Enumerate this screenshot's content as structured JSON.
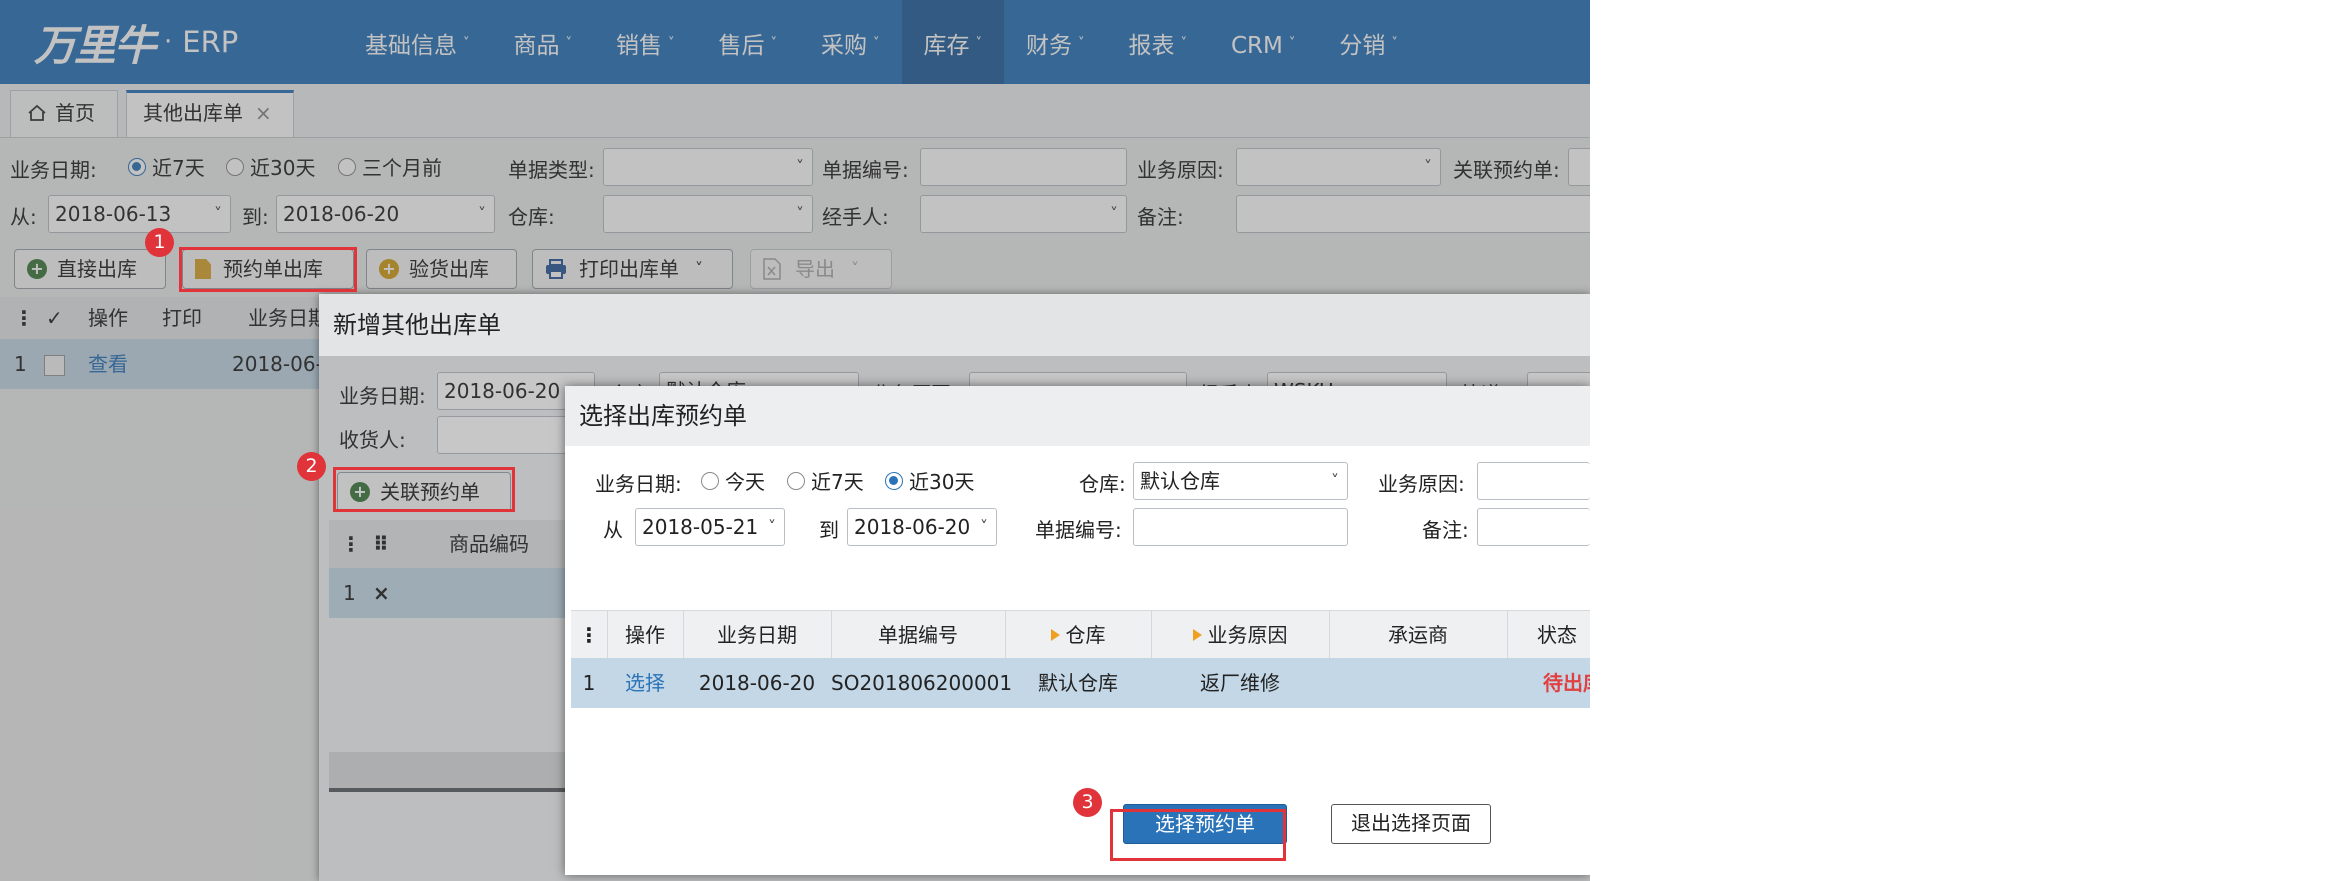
{
  "brand": {
    "logo_text": "万里牛",
    "separator": "·",
    "product": "ERP"
  },
  "nav": {
    "items": [
      {
        "label": "基础信息"
      },
      {
        "label": "商品"
      },
      {
        "label": "销售"
      },
      {
        "label": "售后"
      },
      {
        "label": "采购"
      },
      {
        "label": "库存",
        "active": true
      },
      {
        "label": "财务"
      },
      {
        "label": "报表"
      },
      {
        "label": "CRM"
      },
      {
        "label": "分销"
      }
    ],
    "caret": "˅"
  },
  "tabs": {
    "home": "首页",
    "current": "其他出库单",
    "close": "×"
  },
  "filters": {
    "date_label": "业务日期:",
    "radio_7": "近7天",
    "radio_30": "近30天",
    "radio_3m": "三个月前",
    "selected_range": "近7天",
    "from_label": "从:",
    "from_value": "2018-06-13",
    "to_label": "到:",
    "to_value": "2018-06-20",
    "doc_type_label": "单据类型:",
    "doc_no_label": "单据编号:",
    "reason_label": "业务原因:",
    "linked_label": "关联预约单:",
    "warehouse_label": "仓库:",
    "handler_label": "经手人:",
    "remark_label": "备注:"
  },
  "toolbar": {
    "direct": "直接出库",
    "reserve": "预约单出库",
    "inspect": "验货出库",
    "print": "打印出库单",
    "export": "导出"
  },
  "grid": {
    "headers": {
      "op": "操作",
      "print": "打印",
      "date": "业务日期"
    },
    "row": {
      "index": "1",
      "view": "查看",
      "date": "2018-06-"
    }
  },
  "dialog1": {
    "title": "新增其他出库单",
    "date_label": "业务日期:",
    "date_value": "2018-06-20",
    "warehouse_label": "仓库",
    "warehouse_value": "默认仓库",
    "reason_label": "业务原因",
    "handler_label": "经手人",
    "handler_value": "WSKU",
    "logistics_label": "快递",
    "receiver_label": "收货人:",
    "link_button": "关联预约单",
    "table_header_code": "商品编码",
    "row_index": "1",
    "row_delete": "×"
  },
  "dialog2": {
    "title": "选择出库预约单",
    "date_label": "业务日期:",
    "radio_today": "今天",
    "radio_7": "近7天",
    "radio_30": "近30天",
    "selected_range": "近30天",
    "from_label": "从",
    "from_value": "2018-05-21",
    "to_label": "到",
    "to_value": "2018-06-20",
    "warehouse_label": "仓库:",
    "warehouse_value": "默认仓库",
    "doc_no_label": "单据编号:",
    "reason_label": "业务原因:",
    "remark_label": "备注:",
    "columns": [
      "操作",
      "业务日期",
      "单据编号",
      "仓库",
      "业务原因",
      "承运商",
      "状态"
    ],
    "row": {
      "index": "1",
      "action": "选择",
      "date": "2018-06-20",
      "doc_no": "SO201806200001",
      "warehouse": "默认仓库",
      "reason": "返厂维修",
      "carrier": "",
      "status": "待出库"
    },
    "confirm_button": "选择预约单",
    "exit_button": "退出选择页面"
  },
  "callouts": [
    "1",
    "2",
    "3"
  ],
  "colors": {
    "nav_bg": "#2a73b8",
    "highlight": "#e0333a",
    "selected_row": "#c3d7e6",
    "status_pending": "#e04040"
  }
}
